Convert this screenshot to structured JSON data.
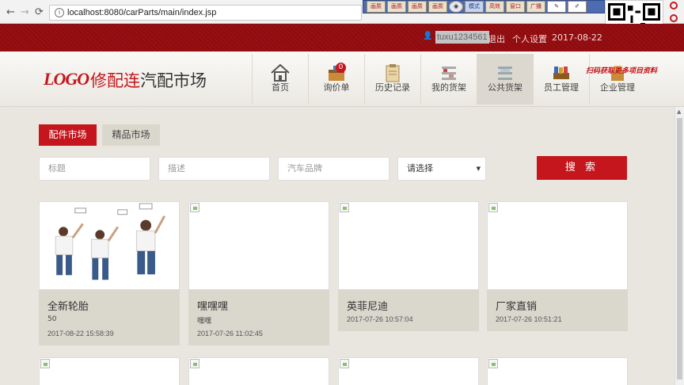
{
  "browser": {
    "back": "←",
    "forward": "→",
    "reload": "C",
    "url": "localhost:8080/carParts/main/index.jsp",
    "toolbar_icons": [
      "画质",
      "画质",
      "画质",
      "画质",
      "",
      "模式",
      "高效",
      "窗口",
      "广播",
      "",
      ""
    ],
    "watermark": "扫码获取更多项目资料"
  },
  "topbar": {
    "username": "tuxu1234561",
    "links": [
      "退出",
      "个人设置"
    ],
    "date": "2017-08-22"
  },
  "header": {
    "logo": "LOGO",
    "brand_highlight": "修配连",
    "brand_rest": "汽配市场",
    "nav": [
      {
        "label": "首页",
        "icon": "home-icon"
      },
      {
        "label": "询价单",
        "icon": "inquiry-box-icon",
        "badge": "0"
      },
      {
        "label": "历史记录",
        "icon": "clipboard-icon"
      },
      {
        "label": "我的货架",
        "icon": "shelf-icon"
      },
      {
        "label": "公共货架",
        "icon": "public-shelf-icon",
        "active": true
      },
      {
        "label": "员工管理",
        "icon": "books-icon"
      },
      {
        "label": "企业管理",
        "icon": "enterprise-icon"
      }
    ]
  },
  "tabs": [
    "配件市场",
    "精品市场"
  ],
  "search": {
    "title_placeholder": "标题",
    "desc_placeholder": "描述",
    "brand_placeholder": "汽车品牌",
    "select_value": "请选择",
    "button": "搜 索"
  },
  "cards": [
    {
      "title": "全新轮胎",
      "desc": "50",
      "time": "2017-08-22 15:58:39",
      "has_image": true
    },
    {
      "title": "嘿嘿嘿",
      "desc": "嘿嘿",
      "time": "2017-07-26 11:02:45",
      "has_image": false
    },
    {
      "title": "英菲尼迪",
      "desc": "",
      "time": "2017-07-26 10:57:04",
      "has_image": false
    },
    {
      "title": "厂家直销",
      "desc": "",
      "time": "2017-07-26 10:51:21",
      "has_image": false
    }
  ],
  "colors": {
    "primary": "#c4161c",
    "topbar": "#9b0f12",
    "card_info": "#dad7cd",
    "background": "#e9e6e0"
  }
}
